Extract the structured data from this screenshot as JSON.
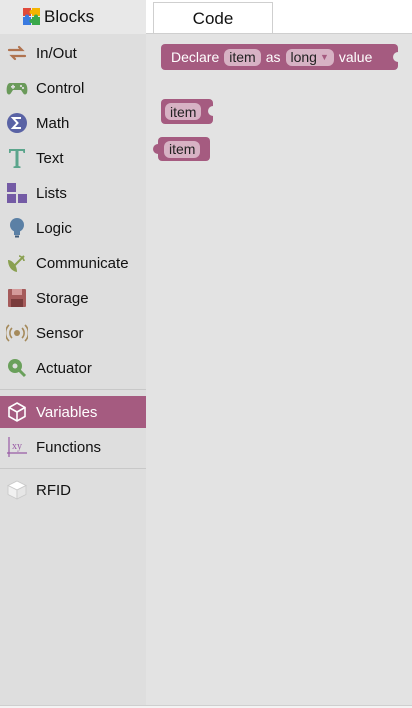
{
  "tabs": {
    "blocks_label": "Blocks",
    "code_label": "Code"
  },
  "sidebar": {
    "items": [
      {
        "label": "In/Out",
        "icon": "arrows-icon",
        "color": "#b0734f"
      },
      {
        "label": "Control",
        "icon": "gamepad-icon",
        "color": "#6a9a5a"
      },
      {
        "label": "Math",
        "icon": "sigma-icon",
        "color": "#5a63a5"
      },
      {
        "label": "Text",
        "icon": "text-t-icon",
        "color": "#5ba58c"
      },
      {
        "label": "Lists",
        "icon": "lists-icon",
        "color": "#745ba5"
      },
      {
        "label": "Logic",
        "icon": "bulb-icon",
        "color": "#5b80a5"
      },
      {
        "label": "Communicate",
        "icon": "satellite-icon",
        "color": "#8aa050"
      },
      {
        "label": "Storage",
        "icon": "floppy-icon",
        "color": "#a55b5b"
      },
      {
        "label": "Sensor",
        "icon": "sensor-icon",
        "color": "#a58a5b"
      },
      {
        "label": "Actuator",
        "icon": "actuator-icon",
        "color": "#6aa05b"
      },
      {
        "label": "Variables",
        "icon": "unity-icon",
        "color": "#a55b80",
        "selected": true
      },
      {
        "label": "Functions",
        "icon": "xy-icon",
        "color": "#995ba5"
      },
      {
        "label": "RFID",
        "icon": "cube-icon",
        "color": "#ffffff"
      }
    ]
  },
  "workspace": {
    "declare_block": {
      "prefix": "Declare",
      "var": "item",
      "as": "as",
      "type": "long",
      "suffix": "value"
    },
    "getter_block": {
      "var": "item"
    },
    "setter_block": {
      "var": "item"
    }
  },
  "colors": {
    "variables": "#a55b80",
    "sidebar_bg": "#dedede",
    "workspace_bg": "#e3e3e3"
  }
}
